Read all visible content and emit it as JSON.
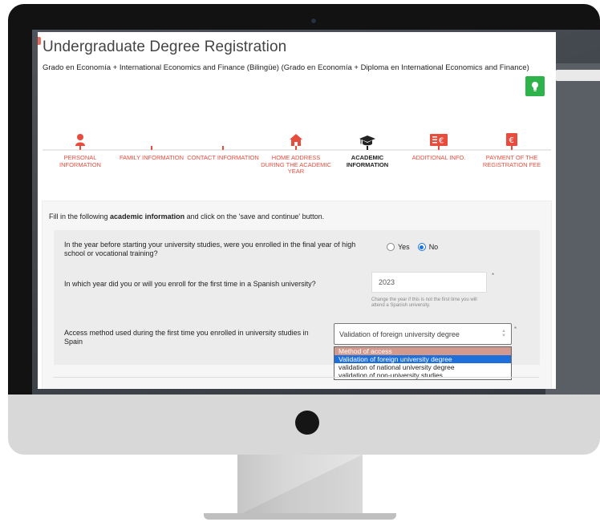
{
  "app": {
    "title": "Undergraduate Degree Registration",
    "subtitle": "Grado en Economía + International Economics and Finance (Bilingüe) (Grado en Economía + Diploma en International Economics and Finance)"
  },
  "steps": [
    {
      "label": "PERSONAL INFORMATION",
      "icon": "person-icon",
      "active": false
    },
    {
      "label": "FAMILY INFORMATION",
      "icon": "",
      "active": false
    },
    {
      "label": "CONTACT INFORMATION",
      "icon": "",
      "active": false
    },
    {
      "label": "HOME ADDRESS DURING THE ACADEMIC YEAR",
      "icon": "home-icon",
      "active": false
    },
    {
      "label": "ACADEMIC INFORMATION",
      "icon": "graduation-cap-icon",
      "active": true
    },
    {
      "label": "ADDITIONAL INFO.",
      "icon": "money-icon",
      "active": false
    },
    {
      "label": "PAYMENT OF THE REGISTRATION FEE",
      "icon": "euro-icon",
      "active": false
    }
  ],
  "form": {
    "intro_prefix": "Fill in the following ",
    "intro_bold": "academic information",
    "intro_suffix": " and click on the 'save and continue' button.",
    "q1": {
      "text": "In the year before starting your university studies, were you enrolled in the final year of high school or vocational training?",
      "options": [
        "Yes",
        "No"
      ],
      "selected": "No"
    },
    "q2": {
      "text": "In which year did you or will you enroll for the first time in a Spanish university?",
      "value": "2023",
      "required_mark": "*",
      "helper": "Change the year if this is not the first time you will attend a Spanish university."
    },
    "q3": {
      "text": "Access method used during the first time you enrolled in university studies in Spain",
      "selected_value": "Validation of foreign university degree",
      "required_mark": "*",
      "options": [
        "Method of access",
        "Validation of foreign university degree",
        "validation of national university degree",
        "validation of non-university studies"
      ],
      "highlighted_index": 1
    }
  },
  "colors": {
    "accent": "#e84c3d",
    "hint_button": "#2db34a",
    "dropdown_selected": "#1e6fd9",
    "dropdown_header": "#d29a8e"
  }
}
